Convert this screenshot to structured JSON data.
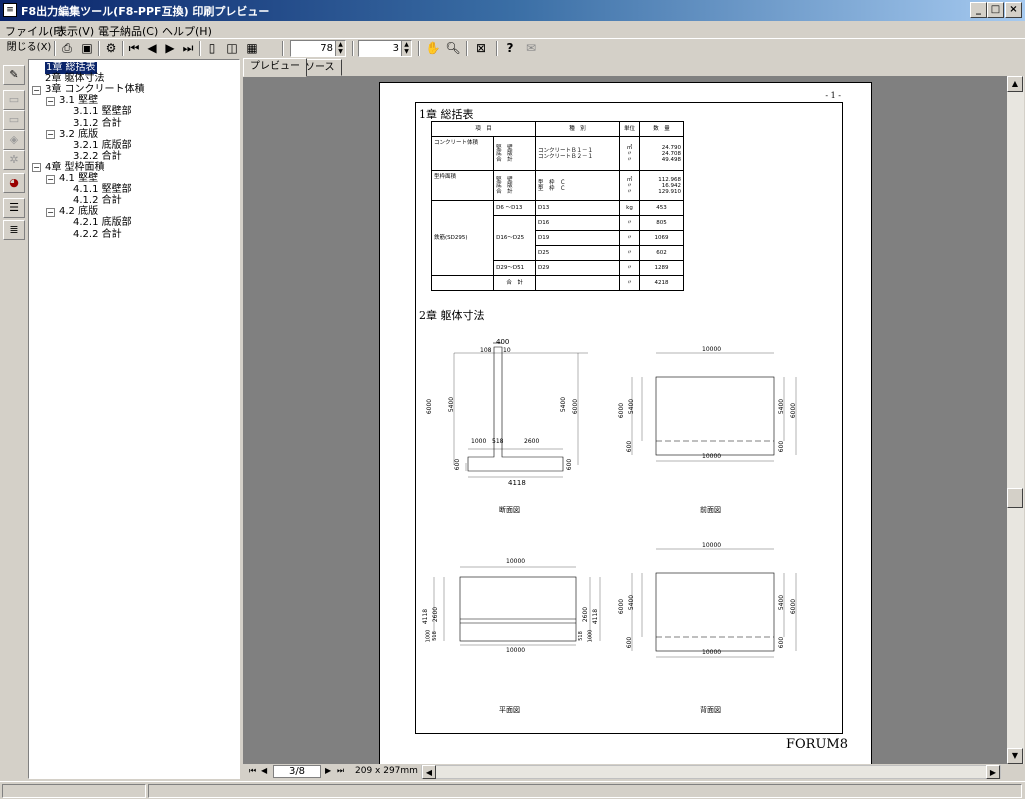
{
  "window": {
    "title": "F8出力編集ツール(F8-PPF互換) 印刷プレビュー",
    "app_icon": "document-icon",
    "controls": [
      "_",
      "□",
      "×"
    ]
  },
  "menu": [
    "ファイル(F)",
    "表示(V)",
    "電子納品(C)",
    "ヘルプ(H)"
  ],
  "toolbar": {
    "close_label": "閉じる(X)",
    "zoom_value": "78",
    "page_value": "3"
  },
  "tree": [
    {
      "label": "1章 総括表",
      "level": 0,
      "selected": true,
      "expander": ""
    },
    {
      "label": "2章 躯体寸法",
      "level": 0,
      "expander": ""
    },
    {
      "label": "3章 コンクリート体積",
      "level": 0,
      "expander": "−"
    },
    {
      "label": "3.1 堅壁",
      "level": 1,
      "expander": "−"
    },
    {
      "label": "3.1.1 堅壁部",
      "level": 2,
      "expander": ""
    },
    {
      "label": "3.1.2 合計",
      "level": 2,
      "expander": ""
    },
    {
      "label": "3.2 底版",
      "level": 1,
      "expander": "−"
    },
    {
      "label": "3.2.1 底版部",
      "level": 2,
      "expander": ""
    },
    {
      "label": "3.2.2 合計",
      "level": 2,
      "expander": ""
    },
    {
      "label": "4章 型枠面積",
      "level": 0,
      "expander": "−"
    },
    {
      "label": "4.1 堅壁",
      "level": 1,
      "expander": "−"
    },
    {
      "label": "4.1.1 堅壁部",
      "level": 2,
      "expander": ""
    },
    {
      "label": "4.1.2 合計",
      "level": 2,
      "expander": ""
    },
    {
      "label": "4.2 底版",
      "level": 1,
      "expander": "−"
    },
    {
      "label": "4.2.1 底版部",
      "level": 2,
      "expander": ""
    },
    {
      "label": "4.2.2 合計",
      "level": 2,
      "expander": ""
    }
  ],
  "tabs": [
    "プレビュー",
    "ソース"
  ],
  "page": {
    "page_number": "- 1 -",
    "section1_title": "1章 総括表",
    "section2_title": "2章 躯体寸法",
    "footer_brand": "FORUM8",
    "table": {
      "headers": [
        "項　目",
        "種　別",
        "単位",
        "数　量"
      ],
      "concrete": {
        "item": "コンクリート体積",
        "parts": "堅　壁\n底　版\n合　計",
        "kind": "コンクリートＢ１－１\nコンクリートＢ２－１",
        "unit": "㎥\n〃\n〃",
        "qty": "24.790\n24.708\n49.498"
      },
      "formwork": {
        "item": "型枠面積",
        "parts": "堅　壁\n底　版\n合　計",
        "kind": "型　枠　Ｃ\n型　枠　Ｃ",
        "unit": "㎡\n〃\n〃",
        "qty": "112.968\n16.942\n129.910"
      },
      "rebar": {
        "item": "鉄筋(SD295)",
        "groups": [
          {
            "range": "D6 ～D13",
            "rows": [
              {
                "kind": "D13",
                "unit": "kg",
                "qty": "453"
              }
            ]
          },
          {
            "range": "D16～D25",
            "rows": [
              {
                "kind": "D16",
                "unit": "〃",
                "qty": "805"
              },
              {
                "kind": "D19",
                "unit": "〃",
                "qty": "1069"
              },
              {
                "kind": "D25",
                "unit": "〃",
                "qty": "602"
              }
            ]
          },
          {
            "range": "D29～D51",
            "rows": [
              {
                "kind": "D29",
                "unit": "〃",
                "qty": "1289"
              }
            ]
          }
        ],
        "total_label": "合　計",
        "total_unit": "〃",
        "total_qty": "4218"
      }
    },
    "drawings": {
      "section": {
        "caption": "断面図",
        "dims": [
          "400",
          "108",
          "10",
          "6000",
          "5400",
          "5400",
          "6000",
          "1000",
          "518",
          "2600",
          "600",
          "600",
          "4118"
        ]
      },
      "front": {
        "caption": "前面図",
        "dims": [
          "10000",
          "6000",
          "5400",
          "5400",
          "6000",
          "600",
          "600",
          "10000"
        ]
      },
      "plan": {
        "caption": "平面図",
        "dims": [
          "10000",
          "4118",
          "2600",
          "2600",
          "4118",
          "1000",
          "518",
          "518",
          "1000",
          "10000"
        ]
      },
      "back": {
        "caption": "背面図",
        "dims": [
          "10000",
          "6000",
          "5400",
          "5400",
          "6000",
          "600",
          "600",
          "10000"
        ]
      }
    }
  },
  "nav": {
    "page_indicator": "3/8",
    "paper_size": "209 x 297mm"
  }
}
